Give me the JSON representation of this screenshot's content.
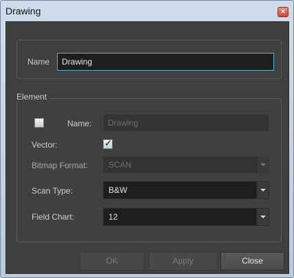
{
  "window": {
    "title": "Drawing",
    "close_icon": "×"
  },
  "name_section": {
    "label": "Name",
    "value": "Drawing"
  },
  "element_section": {
    "legend": "Element",
    "name_label": "Name:",
    "name_value": "Drawing",
    "name_checkbox_checked": false,
    "vector_label": "Vector:",
    "vector_checked": true,
    "bitmap_format_label": "Bitmap Format:",
    "bitmap_format_value": "SCAN",
    "scan_type_label": "Scan Type:",
    "scan_type_value": "B&W",
    "field_chart_label": "Field Chart:",
    "field_chart_value": "12"
  },
  "buttons": {
    "ok": "OK",
    "apply": "Apply",
    "close": "Close"
  },
  "colors": {
    "panel": "#404040",
    "accent": "#5ab0c8",
    "title_bar": "#c5d5e6"
  }
}
